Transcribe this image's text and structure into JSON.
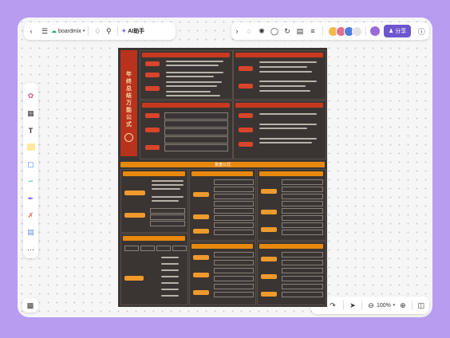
{
  "app": {
    "name": "boardmix",
    "ai_label": "AI助手",
    "share_label": "分享"
  },
  "zoom": {
    "value": "100%"
  },
  "poster": {
    "vertical_title": [
      "年",
      "终",
      "总",
      "结",
      "万",
      "能",
      "公",
      "式"
    ],
    "section_labels": [
      "复盘公式"
    ]
  },
  "colors": {
    "accent": "#6e56cf",
    "poster_bg": "#3a3533",
    "red": "#c9391f",
    "orange": "#e8890e"
  }
}
